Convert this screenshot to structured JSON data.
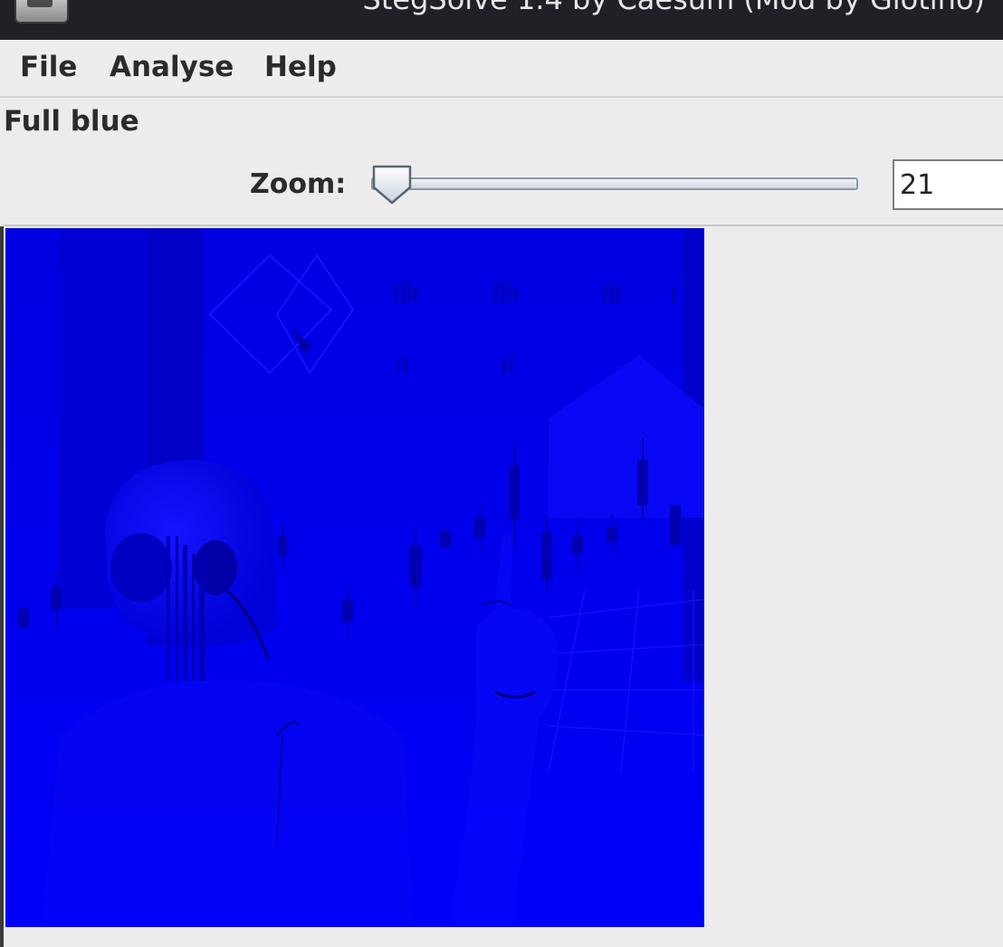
{
  "window": {
    "title": "StegSolve 1.4 by Caesum (Mod by Giotino)"
  },
  "menubar": {
    "items": [
      "File",
      "Analyse",
      "Help"
    ]
  },
  "view": {
    "label": "Full blue"
  },
  "zoom": {
    "label": "Zoom:",
    "value": "21",
    "slider_fraction": 0.02
  },
  "icons": {
    "app": "stegsolve-app-icon",
    "slider_thumb": "slider-thumb-icon"
  },
  "colors": {
    "titlebar_bg": "#1f2126",
    "window_bg": "#ececec",
    "image_blue": "#0000e8"
  }
}
